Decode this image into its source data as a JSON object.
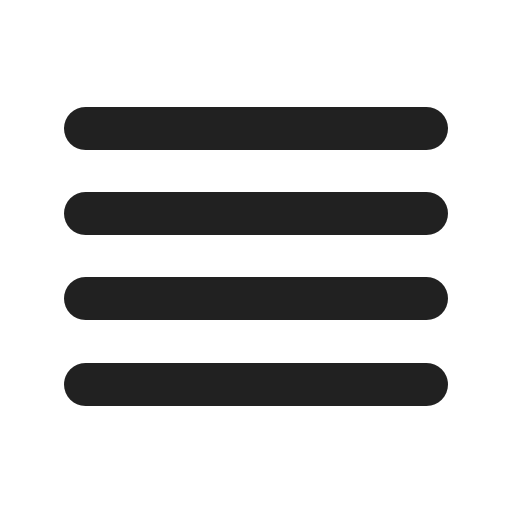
{
  "icon": {
    "name": "hamburger-menu-icon",
    "color": "#212121",
    "background": "#ffffff",
    "line_count": 4
  }
}
